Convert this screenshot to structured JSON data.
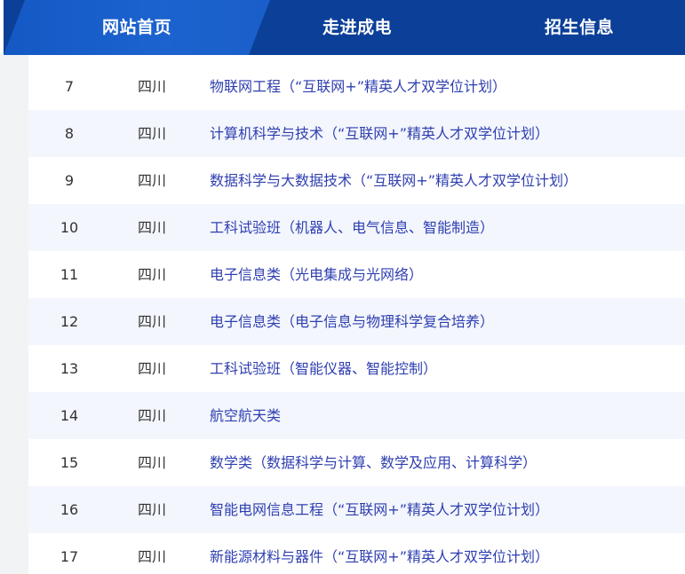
{
  "nav": {
    "items": [
      {
        "label": "网站首页"
      },
      {
        "label": "走进成电"
      },
      {
        "label": "招生信息"
      }
    ]
  },
  "table": {
    "rows": [
      {
        "no": "7",
        "province": "四川",
        "major": "物联网工程（“互联网+”精英人才双学位计划）"
      },
      {
        "no": "8",
        "province": "四川",
        "major": "计算机科学与技术（“互联网+”精英人才双学位计划）"
      },
      {
        "no": "9",
        "province": "四川",
        "major": "数据科学与大数据技术（“互联网+”精英人才双学位计划）"
      },
      {
        "no": "10",
        "province": "四川",
        "major": "工科试验班（机器人、电气信息、智能制造）"
      },
      {
        "no": "11",
        "province": "四川",
        "major": "电子信息类（光电集成与光网络）"
      },
      {
        "no": "12",
        "province": "四川",
        "major": "电子信息类（电子信息与物理科学复合培养）"
      },
      {
        "no": "13",
        "province": "四川",
        "major": "工科试验班（智能仪器、智能控制）"
      },
      {
        "no": "14",
        "province": "四川",
        "major": "航空航天类"
      },
      {
        "no": "15",
        "province": "四川",
        "major": "数学类（数据科学与计算、数学及应用、计算科学）"
      },
      {
        "no": "16",
        "province": "四川",
        "major": "智能电网信息工程（“互联网+”精英人才双学位计划）"
      },
      {
        "no": "17",
        "province": "四川",
        "major": "新能源材料与器件（“互联网+”精英人才双学位计划）"
      }
    ]
  }
}
